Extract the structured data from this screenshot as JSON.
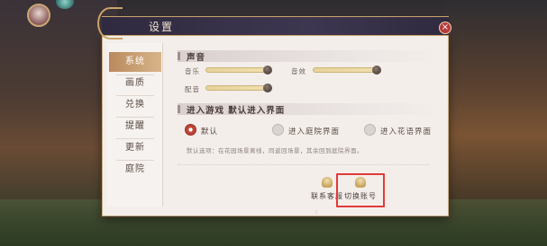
{
  "dialog": {
    "title": "设置",
    "close_glyph": "×"
  },
  "sidebar": {
    "items": [
      {
        "label": "系统",
        "active": true
      },
      {
        "label": "画质",
        "active": false
      },
      {
        "label": "兑换",
        "active": false
      },
      {
        "label": "提醒",
        "active": false
      },
      {
        "label": "更新",
        "active": false
      },
      {
        "label": "庭院",
        "active": false
      }
    ]
  },
  "sound": {
    "title": "声音",
    "music_label": "音乐",
    "sfx_label": "音效",
    "voice_label": "配音",
    "music_value": 1.0,
    "sfx_value": 1.0,
    "voice_value": 1.0
  },
  "entry": {
    "title": "进入游戏 默认进入界面",
    "options": [
      {
        "label": "默认",
        "selected": true
      },
      {
        "label": "进入庭院界面",
        "selected": false
      },
      {
        "label": "进入花语界面",
        "selected": false
      }
    ],
    "hint": "默认选项：在花园场景离线，同返回场景，其余回到庭院界面。"
  },
  "footer": {
    "contact_label": "联系客服",
    "switch_label": "切换账号"
  },
  "icons": {
    "contact": "headset-icon",
    "switch": "user-icon",
    "close": "close-icon"
  },
  "colors": {
    "accent": "#b98a5e",
    "highlight": "#e23a3a",
    "radio_selected": "#b23a2f"
  }
}
